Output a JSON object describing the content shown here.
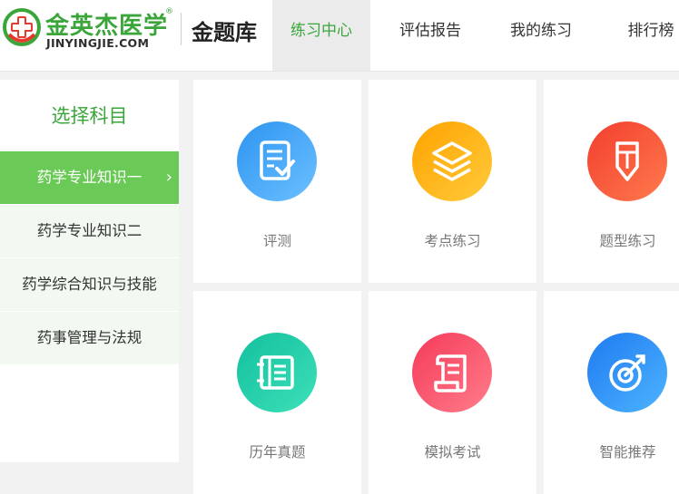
{
  "brand": {
    "name_cn": "金英杰医学",
    "registered": "®",
    "domain": "JINYINGJIE.COM",
    "section": "金题库",
    "color": "#3aa63a"
  },
  "nav": [
    {
      "label": "练习中心",
      "active": true
    },
    {
      "label": "评估报告",
      "active": false
    },
    {
      "label": "我的练习",
      "active": false
    },
    {
      "label": "排行榜",
      "active": false
    }
  ],
  "sidebar": {
    "title": "选择科目",
    "active_color": "#6bc957",
    "items": [
      {
        "label": "药学专业知识一",
        "active": true
      },
      {
        "label": "药学专业知识二",
        "active": false
      },
      {
        "label": "药学综合知识与技能",
        "active": false
      },
      {
        "label": "药事管理与法规",
        "active": false
      }
    ]
  },
  "cards": [
    {
      "label": "评测",
      "icon": "document-check-icon",
      "color": "#3aa0f5"
    },
    {
      "label": "考点练习",
      "icon": "layers-icon",
      "color": "#ffb41a"
    },
    {
      "label": "题型练习",
      "icon": "pencil-badge-icon",
      "color": "#f55536"
    },
    {
      "label": "历年真题",
      "icon": "notebook-icon",
      "color": "#1fc9a6"
    },
    {
      "label": "模拟考试",
      "icon": "scroll-icon",
      "color": "#f7506a"
    },
    {
      "label": "智能推荐",
      "icon": "target-icon",
      "color": "#2f8cf5"
    }
  ]
}
